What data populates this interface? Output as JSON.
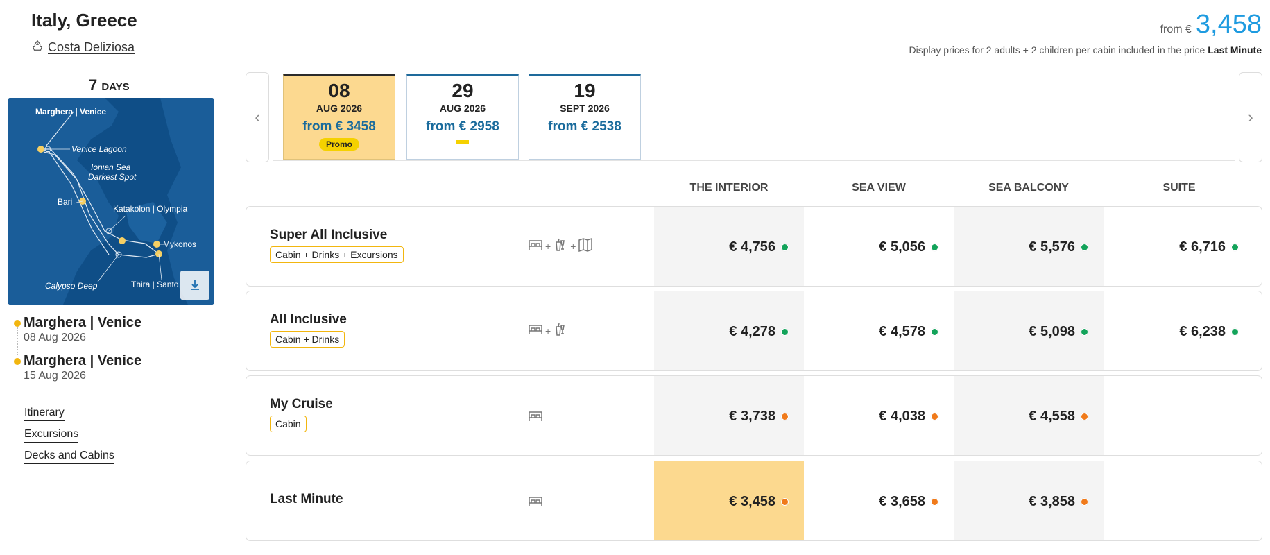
{
  "header": {
    "title": "Italy, Greece",
    "ship_name": "Costa Deliziosa",
    "from_label": "from €",
    "from_price": "3,458",
    "display_prices_text": "Display prices for 2 adults + 2 children per cabin included in the price",
    "display_prices_bold": "Last Minute"
  },
  "itinerary": {
    "days_number": "7",
    "days_unit": "DAYS",
    "map_labels": {
      "venice": "Marghera | Venice",
      "lagoon": "Venice Lagoon",
      "ionian_1": "Ionian Sea",
      "ionian_2": "Darkest Spot",
      "bari": "Bari",
      "katakolon": "Katakolon | Olympia",
      "mykonos": "Mykonos",
      "calypso": "Calypso Deep",
      "thira": "Thira | Santo"
    },
    "ports": [
      {
        "name": "Marghera | Venice",
        "date": "08 Aug 2026"
      },
      {
        "name": "Marghera | Venice",
        "date": "15 Aug 2026"
      }
    ],
    "links": [
      "Itinerary",
      "Excursions",
      "Decks and Cabins"
    ]
  },
  "dates": [
    {
      "day": "08",
      "month": "AUG 2026",
      "price": "from € 3458",
      "badge": "Promo",
      "selected": true
    },
    {
      "day": "29",
      "month": "AUG 2026",
      "price": "from € 2958"
    },
    {
      "day": "19",
      "month": "SEPT 2026",
      "price": "from € 2538"
    }
  ],
  "columns": [
    "THE INTERIOR",
    "SEA VIEW",
    "SEA BALCONY",
    "SUITE"
  ],
  "rows": [
    {
      "label": "Super All Inclusive",
      "tag": "Cabin + Drinks + Excursions",
      "prices": [
        "€ 4,756",
        "€ 5,056",
        "€ 5,576",
        "€ 6,716"
      ],
      "status": "available"
    },
    {
      "label": "All Inclusive",
      "tag": "Cabin + Drinks",
      "prices": [
        "€ 4,278",
        "€ 4,578",
        "€ 5,098",
        "€ 6,238"
      ],
      "status": "available"
    },
    {
      "label": "My Cruise",
      "tag": "Cabin",
      "prices": [
        "€ 3,738",
        "€ 4,038",
        "€ 4,558",
        ""
      ],
      "status": "limited"
    },
    {
      "label": "Last Minute",
      "tag": "",
      "prices": [
        "€ 3,458",
        "€ 3,658",
        "€ 3,858",
        ""
      ],
      "status": "limited"
    }
  ],
  "colors": {
    "accent_blue": "#1e9be0",
    "date_price_blue": "#1a6b9c",
    "selected_yellow": "#fcd990",
    "tag_border": "#f2b60f",
    "dot_available": "#13a35a",
    "dot_limited": "#f07a1a"
  },
  "icons": {
    "ship": "ship-icon",
    "cabin": "bed-icon",
    "drinks": "drinks-icon",
    "excursions": "map-icon",
    "download": "download-icon",
    "prev": "chevron-left-icon",
    "next": "chevron-right-icon"
  }
}
